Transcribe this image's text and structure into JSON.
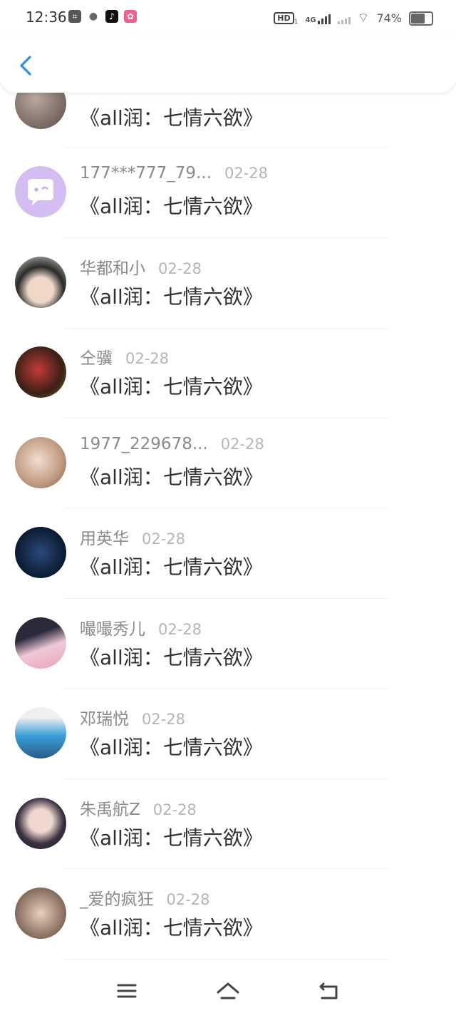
{
  "status_bar": {
    "time": "12:36",
    "network_badge": "HD",
    "network_sub": "1",
    "network_type": "4G",
    "battery_text": "74%",
    "battery_level": 0.74
  },
  "header": {
    "back_icon": "chevron-left-icon",
    "accent_color": "#2f8ee6"
  },
  "comments": [
    {
      "name": "",
      "date": "",
      "title": "《all润：七情六欲》"
    },
    {
      "name": "177***777_79...",
      "date": "02-28",
      "title": "《all润：七情六欲》"
    },
    {
      "name": "华都和小",
      "date": "02-28",
      "title": "《all润：七情六欲》"
    },
    {
      "name": "仝骥",
      "date": "02-28",
      "title": "《all润：七情六欲》"
    },
    {
      "name": "1977_229678...",
      "date": "02-28",
      "title": "《all润：七情六欲》"
    },
    {
      "name": "用英华",
      "date": "02-28",
      "title": "《all润：七情六欲》"
    },
    {
      "name": "嘬嘬秀儿",
      "date": "02-28",
      "title": "《all润：七情六欲》"
    },
    {
      "name": "邓瑞悦",
      "date": "02-28",
      "title": "《all润：七情六欲》"
    },
    {
      "name": "朱禹航Z",
      "date": "02-28",
      "title": "《all润：七情六欲》"
    },
    {
      "name": "_爱的疯狂",
      "date": "02-28",
      "title": "《all润：七情六欲》"
    }
  ],
  "nav_bar": {
    "menu_icon": "menu-icon",
    "home_icon": "home-icon",
    "back_icon": "back-icon"
  }
}
